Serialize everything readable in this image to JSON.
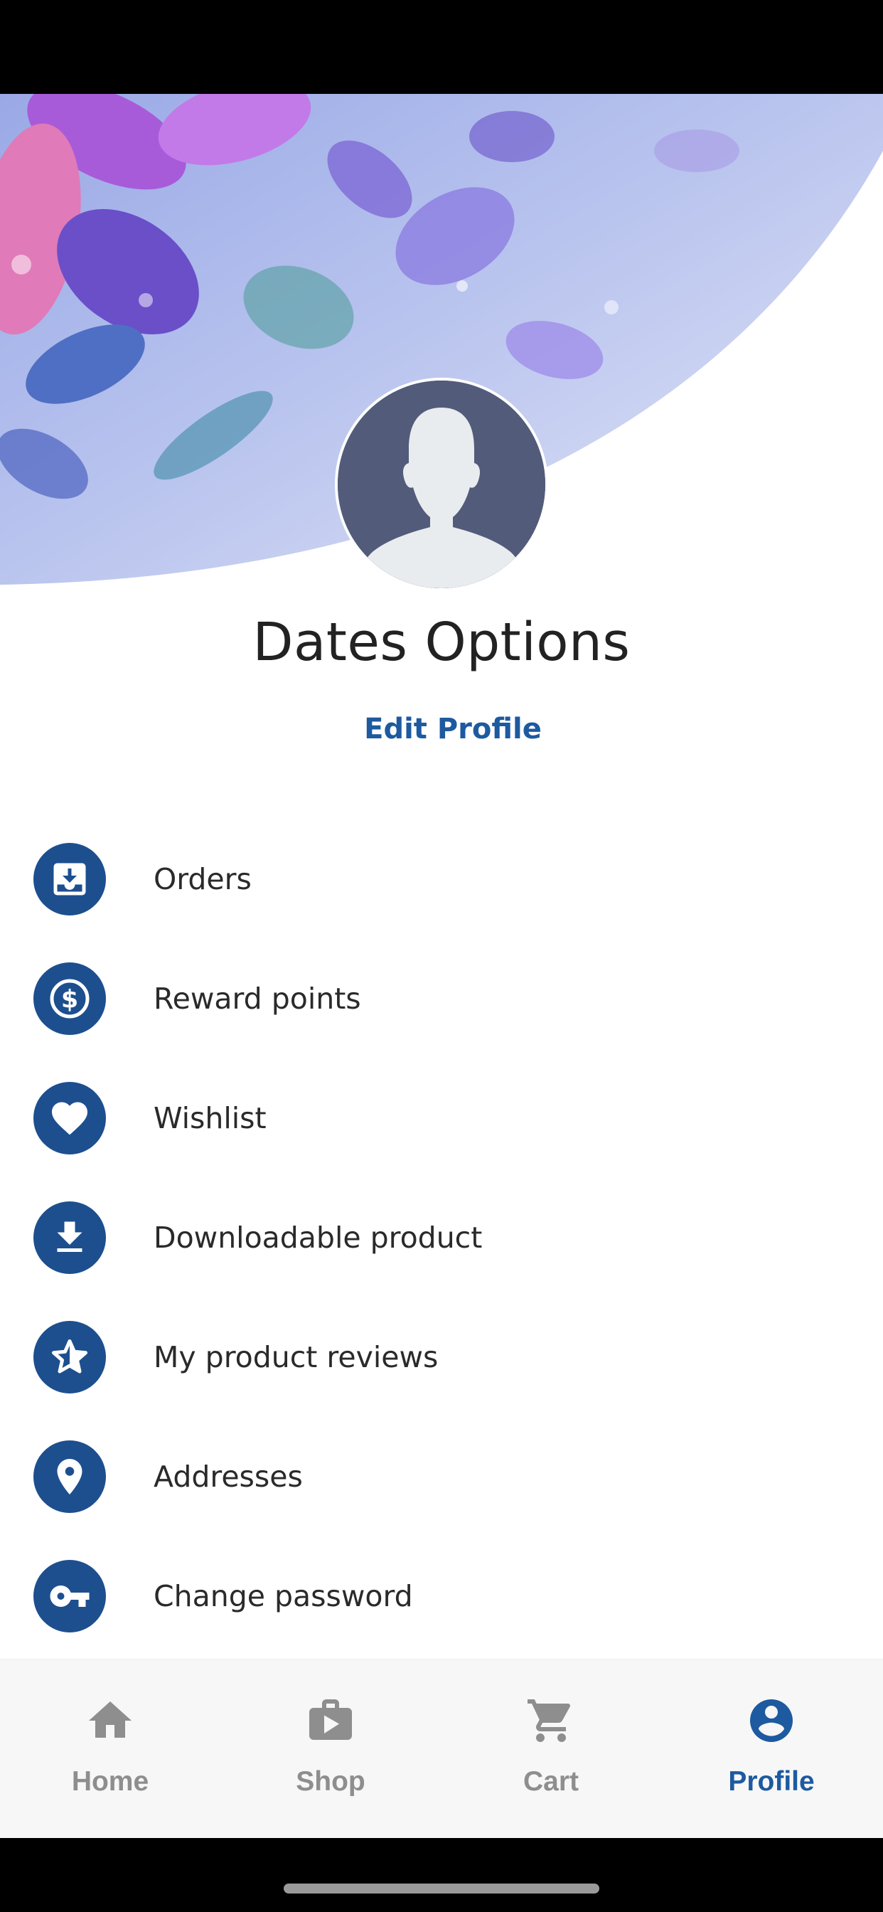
{
  "profile": {
    "name": "Dates Options",
    "edit_label": "Edit Profile"
  },
  "menu": {
    "items": [
      {
        "label": "Orders",
        "icon": "inbox-download-icon"
      },
      {
        "label": "Reward points",
        "icon": "dollar-circle-icon"
      },
      {
        "label": "Wishlist",
        "icon": "heart-icon"
      },
      {
        "label": "Downloadable product",
        "icon": "download-icon"
      },
      {
        "label": "My product reviews",
        "icon": "star-icon"
      },
      {
        "label": "Addresses",
        "icon": "location-pin-icon"
      },
      {
        "label": "Change password",
        "icon": "key-icon"
      }
    ]
  },
  "bottom_nav": {
    "items": [
      {
        "label": "Home",
        "icon": "home-icon",
        "active": false
      },
      {
        "label": "Shop",
        "icon": "shopping-bag-icon",
        "active": false
      },
      {
        "label": "Cart",
        "icon": "cart-icon",
        "active": false
      },
      {
        "label": "Profile",
        "icon": "account-circle-icon",
        "active": true
      }
    ]
  },
  "colors": {
    "accent": "#1d5aa0",
    "icon_circle": "#1d4f8f",
    "avatar_bg": "#525b7a",
    "nav_inactive": "#8e8e8e",
    "nav_bg": "#f7f7f7"
  }
}
